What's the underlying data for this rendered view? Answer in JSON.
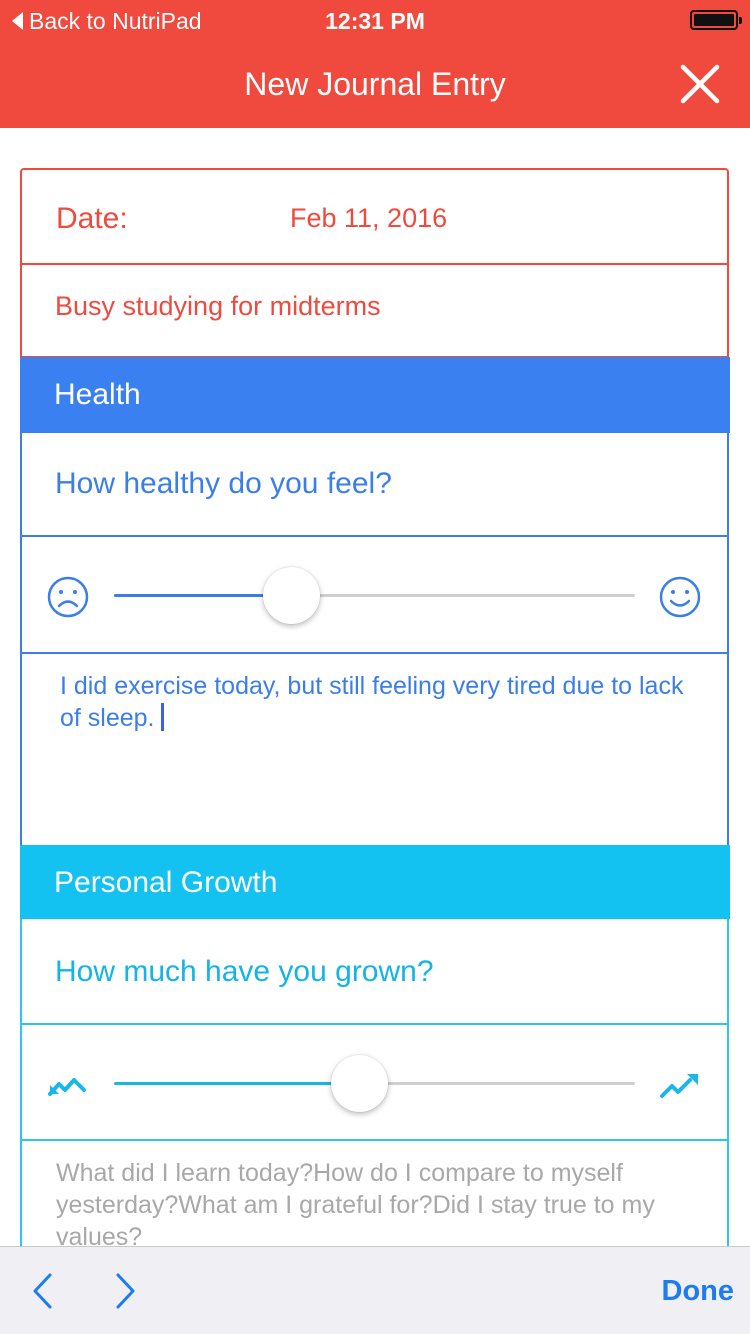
{
  "status_bar": {
    "back_label": "Back to NutriPad",
    "time": "12:31 PM",
    "battery_icon": "battery-icon"
  },
  "nav": {
    "title": "New Journal Entry",
    "close_icon": "close-icon"
  },
  "entry": {
    "date_label": "Date:",
    "date_value": "Feb 11, 2016",
    "note": "Busy studying for midterms"
  },
  "health": {
    "header": "Health",
    "question": "How healthy do you feel?",
    "slider_value": 0.34,
    "left_icon": "sad-face-icon",
    "right_icon": "happy-face-icon",
    "comment": "I did exercise today, but still feeling very tired due to lack of sleep."
  },
  "growth": {
    "header": "Personal Growth",
    "question": "How much have you grown?",
    "slider_value": 0.47,
    "left_icon": "trend-down-icon",
    "right_icon": "trend-up-icon",
    "comment_placeholder": "What did I learn today?How do I compare to myself yesterday?What am I grateful for?Did I stay true to my values?"
  },
  "toolbar": {
    "prev_icon": "chevron-left-icon",
    "next_icon": "chevron-right-icon",
    "done_label": "Done"
  },
  "colors": {
    "brand_red": "#f04a3e",
    "health_blue": "#3b80f0",
    "growth_cyan": "#13c2f0",
    "done_blue": "#1c7cf0"
  }
}
